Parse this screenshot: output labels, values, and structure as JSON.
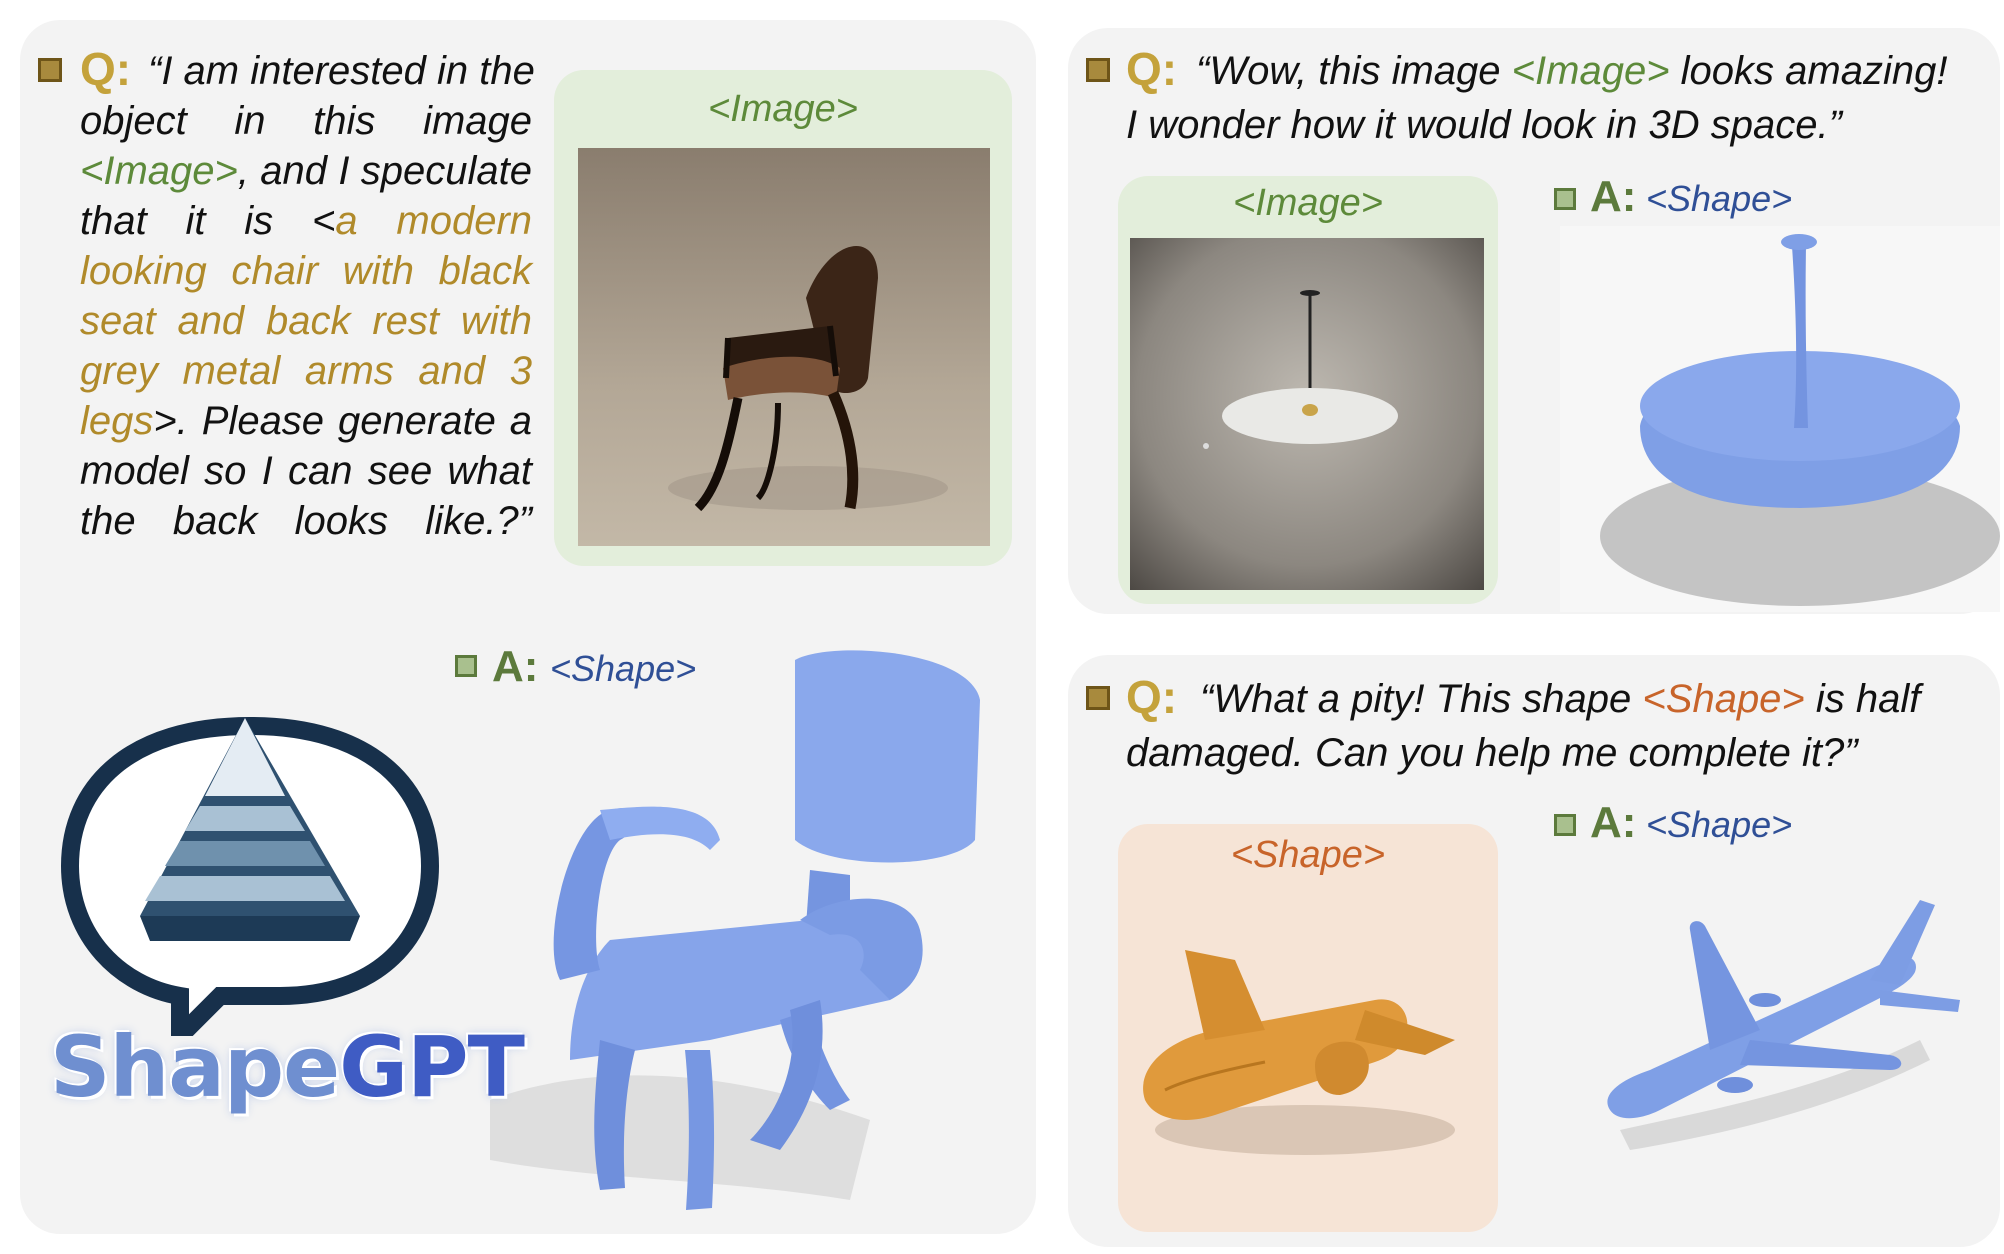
{
  "left_panel": {
    "q_label": "Q:",
    "question_lines": [
      [
        {
          "t": "“I am interested in the",
          "c": ""
        }
      ],
      [
        {
          "t": "object in this image",
          "c": ""
        }
      ],
      [
        {
          "t": "<Image>",
          "c": "tag-image"
        },
        {
          "t": ", and I speculate",
          "c": ""
        }
      ],
      [
        {
          "t": "that it is <",
          "c": ""
        },
        {
          "t": "a modern",
          "c": "tag-desc"
        }
      ],
      [
        {
          "t": "looking chair with black",
          "c": "tag-desc"
        }
      ],
      [
        {
          "t": "seat and back rest with",
          "c": "tag-desc"
        }
      ],
      [
        {
          "t": "grey metal arms and 3",
          "c": "tag-desc"
        }
      ],
      [
        {
          "t": "legs",
          "c": "tag-desc"
        },
        {
          "t": ">. Please generate a",
          "c": ""
        }
      ],
      [
        {
          "t": "model so I can see what",
          "c": ""
        }
      ],
      [
        {
          "t": "the back looks like.?”",
          "c": ""
        }
      ]
    ],
    "image_card_label": "<Image>",
    "a_label": "A:",
    "a_shape": "<Shape>",
    "logo_text_1": "Shape",
    "logo_text_2": "GPT"
  },
  "top_right_panel": {
    "q_label": "Q:",
    "question_line_1_a": "“Wow, this image ",
    "question_line_1_tag": "<Image>",
    "question_line_1_b": " looks amazing!",
    "question_line_2": "I wonder how it would look in 3D space.”",
    "image_card_label": "<Image>",
    "a_label": "A:",
    "a_shape": "<Shape>"
  },
  "bottom_right_panel": {
    "q_label": "Q:",
    "question_line_1_a": "“What a pity! This shape ",
    "question_line_1_tag": "<Shape>",
    "question_line_1_b": " is half",
    "question_line_2": "damaged. Can you help me complete it?”",
    "shape_card_label": "<Shape>",
    "a_label": "A:",
    "a_shape": "<Shape>"
  },
  "colors": {
    "q_gold": "#c4a23b",
    "a_green": "#5c7a3c",
    "image_tag_green": "#5d8a3a",
    "description_gold": "#b08a2a",
    "shape_tag_blue": "#2f4f96",
    "shape_tag_orange": "#c8642a",
    "shape_blue": "#7f9fe6",
    "shape_orange": "#e09a3c"
  }
}
